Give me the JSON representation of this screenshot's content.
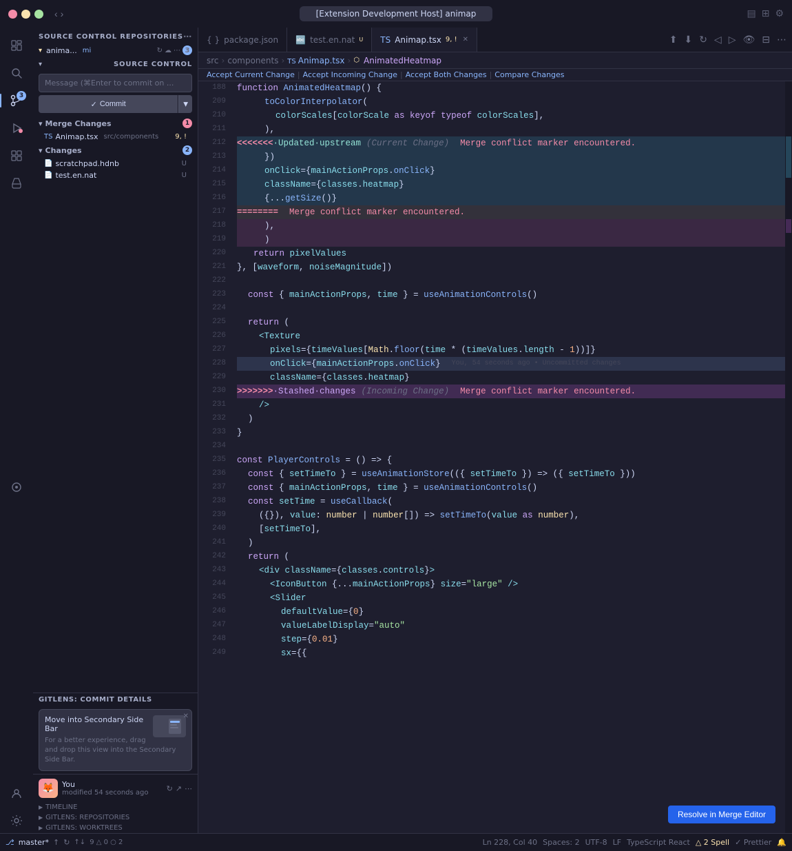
{
  "titlebar": {
    "title": "[Extension Development Host] animap",
    "nav_back": "‹",
    "nav_forward": "›"
  },
  "tabs": [
    {
      "id": "package",
      "label": "package.json",
      "active": false,
      "modified": false
    },
    {
      "id": "test",
      "label": "test.en.nat",
      "active": false,
      "modified": true
    },
    {
      "id": "animap",
      "label": "Animap.tsx",
      "active": true,
      "modified": true,
      "extra": "9, !"
    }
  ],
  "breadcrumb": {
    "parts": [
      "src",
      "components",
      "Animap.tsx",
      "AnimatedHeatmap"
    ]
  },
  "conflict_bar": {
    "accept_current": "Accept Current Change",
    "accept_incoming": "Accept Incoming Change",
    "accept_both": "Accept Both Changes",
    "compare": "Compare Changes"
  },
  "sidebar": {
    "repos_header": "SOURCE CONTROL REPOSITORIES",
    "source_control_header": "SOURCE CONTROL",
    "repo_name": "anima...",
    "repo_branch": "mi",
    "repo_count": "3",
    "commit_placeholder": "Message (⌘Enter to commit on ...",
    "commit_label": "Commit",
    "merge_changes_label": "Merge Changes",
    "merge_badge": "1",
    "merge_file": "Animap.tsx",
    "merge_path": "src/components",
    "merge_status": "9, !",
    "changes_label": "Changes",
    "changes_badge": "2",
    "change_file1": "scratchpad.hdnb",
    "change_file2": "test.en.nat",
    "timeline_label": "TIMELINE",
    "gitlens_repos_label": "GITLENS: REPOSITORIES",
    "gitlens_commit_label": "GITLENS: COMMIT DETAILS",
    "worktrees_label": "GITLENS: WORKTREES"
  },
  "tooltip": {
    "title": "Move into Secondary Side Bar",
    "body": "For a better experience, drag and drop this view into the Secondary Side Bar."
  },
  "user": {
    "name": "You",
    "time": "modified 54 seconds ago"
  },
  "status_bar": {
    "branch": "master*",
    "sync": "↑",
    "errors": "⚠ 9",
    "warnings": "△ 0",
    "line_col": "Ln 228, Col 40",
    "spaces": "Spaces: 2",
    "encoding": "UTF-8",
    "eol": "LF",
    "language": "TypeScript React",
    "spell": "△ 2 Spell",
    "prettier": "✓ Prettier"
  },
  "code_lines": [
    {
      "num": 188,
      "content": "function AnimatedHeatmap() {",
      "type": "normal"
    },
    {
      "num": 209,
      "content": "  toColorInterpolator(",
      "type": "normal"
    },
    {
      "num": 210,
      "content": "    colorScales[colorScale as keyof typeof colorScales],",
      "type": "normal"
    },
    {
      "num": 211,
      "content": "  ),",
      "type": "normal"
    },
    {
      "num": 212,
      "content": "<<<<<<< Updated upstream  (Current Change)   Merge conflict marker encountered.",
      "type": "merge-current"
    },
    {
      "num": 213,
      "content": "    })",
      "type": "merge-current"
    },
    {
      "num": 214,
      "content": "    onClick={mainActionProps.onClick}",
      "type": "merge-current"
    },
    {
      "num": 215,
      "content": "    className={classes.heatmap}",
      "type": "merge-current"
    },
    {
      "num": 216,
      "content": "    {...getSize()}",
      "type": "merge-current"
    },
    {
      "num": 217,
      "content": "=======     Merge conflict marker encountered.",
      "type": "merge-separator"
    },
    {
      "num": 218,
      "content": "  ),",
      "type": "merge-incoming"
    },
    {
      "num": 219,
      "content": "  )",
      "type": "merge-incoming"
    },
    {
      "num": 220,
      "content": "  return pixelValues",
      "type": "normal"
    },
    {
      "num": 221,
      "content": "}, [waveform, noiseMagnitude])",
      "type": "normal"
    },
    {
      "num": 222,
      "content": "",
      "type": "normal"
    },
    {
      "num": 223,
      "content": "  const { mainActionProps, time } = useAnimationControls()",
      "type": "normal"
    },
    {
      "num": 224,
      "content": "",
      "type": "normal"
    },
    {
      "num": 225,
      "content": "  return (",
      "type": "normal"
    },
    {
      "num": 226,
      "content": "    <Texture",
      "type": "normal"
    },
    {
      "num": 227,
      "content": "      pixels={timeValues[Math.floor(time * (timeValues.length - 1))]}",
      "type": "normal"
    },
    {
      "num": 228,
      "content": "      onClick={mainActionProps.onClick}                   You, 54 seconds ago • Uncommitted changes",
      "type": "selected"
    },
    {
      "num": 229,
      "content": "      className={classes.heatmap}",
      "type": "normal"
    },
    {
      "num": 230,
      "content": ">>>>>>> Stashed changes  (Incoming Change)    Merge conflict marker encountered.",
      "type": "merge-incoming-marker"
    },
    {
      "num": 231,
      "content": "    />",
      "type": "normal"
    },
    {
      "num": 232,
      "content": "  )",
      "type": "normal"
    },
    {
      "num": 233,
      "content": "}",
      "type": "normal"
    },
    {
      "num": 234,
      "content": "",
      "type": "normal"
    },
    {
      "num": 235,
      "content": "const PlayerControls = () => {",
      "type": "normal"
    },
    {
      "num": 236,
      "content": "  const { setTimeTo } = useAnimationStore(({ setTimeTo }) => ({ setTimeTo }))",
      "type": "normal"
    },
    {
      "num": 237,
      "content": "  const { mainActionProps, time } = useAnimationControls()",
      "type": "normal"
    },
    {
      "num": 238,
      "content": "  const setTime = useCallback(",
      "type": "normal"
    },
    {
      "num": 239,
      "content": "    ({}, value: number | number[]) => setTimeTo(value as number),",
      "type": "normal"
    },
    {
      "num": 240,
      "content": "    [setTimeTo],",
      "type": "normal"
    },
    {
      "num": 241,
      "content": "  )",
      "type": "normal"
    },
    {
      "num": 242,
      "content": "  return (",
      "type": "normal"
    },
    {
      "num": 243,
      "content": "    <div className={classes.controls}>",
      "type": "normal"
    },
    {
      "num": 244,
      "content": "      <IconButton {...mainActionProps} size=\"large\" />",
      "type": "normal"
    },
    {
      "num": 245,
      "content": "      <Slider",
      "type": "normal"
    },
    {
      "num": 246,
      "content": "        defaultValue={0}",
      "type": "normal"
    },
    {
      "num": 247,
      "content": "        valueLabelDisplay=\"auto\"",
      "type": "normal"
    },
    {
      "num": 248,
      "content": "        step={0.01}",
      "type": "normal"
    },
    {
      "num": 249,
      "content": "        sx={{",
      "type": "normal"
    }
  ],
  "resolve_btn": "Resolve in Merge Editor"
}
